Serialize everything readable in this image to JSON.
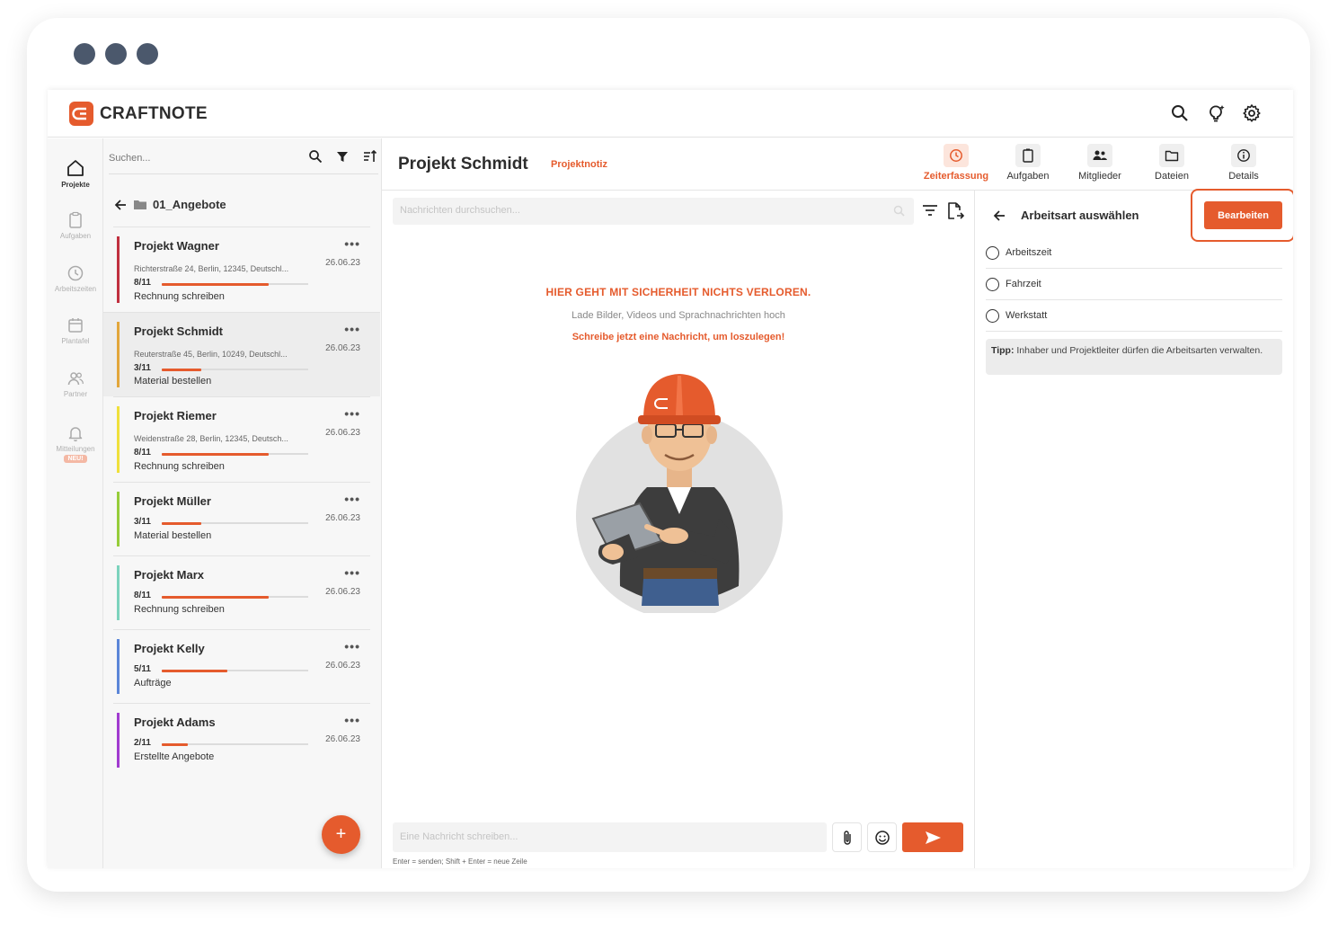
{
  "app": {
    "brand": "CRAFTNOTE",
    "accent": "#e55b2d"
  },
  "rail": {
    "items": [
      {
        "label": "Projekte",
        "icon": "home-icon"
      },
      {
        "label": "Aufgaben",
        "icon": "clipboard-icon"
      },
      {
        "label": "Arbeitszeiten",
        "icon": "clock-icon"
      },
      {
        "label": "Plantafel",
        "icon": "calendar-icon"
      },
      {
        "label": "Partner",
        "icon": "people-icon"
      },
      {
        "label": "Mitteilungen",
        "icon": "bell-icon",
        "badge": "NEU!"
      }
    ]
  },
  "projects": {
    "search_placeholder": "Suchen...",
    "folder": "01_Angebote",
    "items": [
      {
        "name": "Projekt Wagner",
        "address": "Richterstraße 24, Berlin, 12345, Deutschl...",
        "date": "26.06.23",
        "count": "8/11",
        "progress": 0.73,
        "status": "Rechnung schreiben",
        "color": "#c0303f"
      },
      {
        "name": "Projekt Schmidt",
        "address": "Reuterstraße 45, Berlin, 10249, Deutschl...",
        "date": "26.06.23",
        "count": "3/11",
        "progress": 0.27,
        "status": "Material bestellen",
        "color": "#e2a63b"
      },
      {
        "name": "Projekt Riemer",
        "address": "Weidenstraße 28, Berlin, 12345, Deutsch...",
        "date": "26.06.23",
        "count": "8/11",
        "progress": 0.73,
        "status": "Rechnung schreiben",
        "color": "#efe03b"
      },
      {
        "name": "Projekt Müller",
        "address": "",
        "date": "26.06.23",
        "count": "3/11",
        "progress": 0.27,
        "status": "Material bestellen",
        "color": "#96cd3a"
      },
      {
        "name": "Projekt Marx",
        "address": "",
        "date": "26.06.23",
        "count": "8/11",
        "progress": 0.73,
        "status": "Rechnung schreiben",
        "color": "#7cd3bd"
      },
      {
        "name": "Projekt Kelly",
        "address": "",
        "date": "26.06.23",
        "count": "5/11",
        "progress": 0.45,
        "status": "Aufträge",
        "color": "#5b86d8"
      },
      {
        "name": "Projekt Adams",
        "address": "",
        "date": "26.06.23",
        "count": "2/11",
        "progress": 0.18,
        "status": "Erstellte Angebote",
        "color": "#a13bd0"
      }
    ],
    "add_label": "+"
  },
  "header": {
    "title": "Projekt Schmidt",
    "subtitle": "Projektnotiz",
    "tabs": [
      {
        "label": "Zeiterfassung",
        "icon": "clock-icon",
        "active": true
      },
      {
        "label": "Aufgaben",
        "icon": "clipboard-icon",
        "active": false
      },
      {
        "label": "Mitglieder",
        "icon": "members-icon",
        "active": false
      },
      {
        "label": "Dateien",
        "icon": "folder-icon",
        "active": false
      },
      {
        "label": "Details",
        "icon": "info-icon",
        "active": false
      }
    ]
  },
  "chat": {
    "search_placeholder": "Nachrichten durchsuchen...",
    "empty_title": "HIER GEHT MIT SICHERHEIT NICHTS VERLOREN.",
    "empty_subtitle": "Lade Bilder, Videos und Sprachnachrichten hoch",
    "empty_cta": "Schreibe jetzt eine Nachricht, um loszulegen!",
    "composer_placeholder": "Eine Nachricht schreiben...",
    "hint": "Enter = senden; Shift + Enter = neue Zeile"
  },
  "panel": {
    "title": "Arbeitsart auswählen",
    "edit_label": "Bearbeiten",
    "options": [
      "Arbeitszeit",
      "Fahrzeit",
      "Werkstatt"
    ],
    "tip_label": "Tipp:",
    "tip_text": " Inhaber und Projektleiter dürfen die Arbeitsarten verwalten."
  }
}
